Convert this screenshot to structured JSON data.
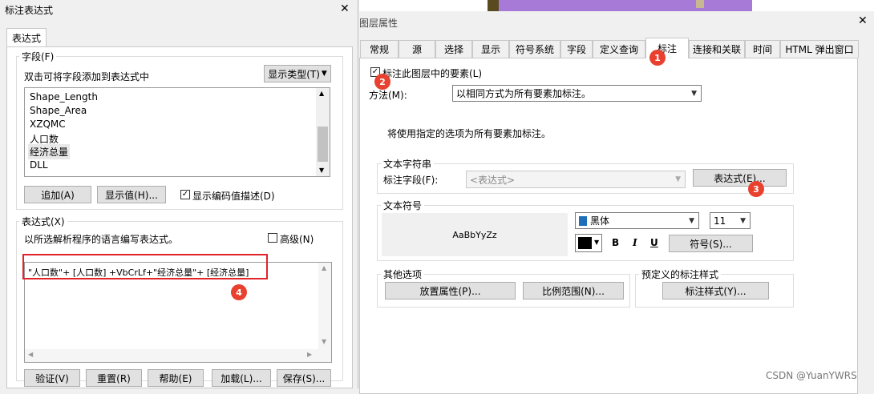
{
  "left": {
    "title": "标注表达式",
    "close": "✕",
    "tab": "表达式",
    "fields": {
      "group_title": "字段(F)",
      "hint": "双击可将字段添加到表达式中",
      "show_type": "显示类型(T)",
      "items": [
        "Shape_Length",
        "Shape_Area",
        "XZQMC",
        "人口数",
        "经济总量",
        "DLL"
      ],
      "add_btn": "追加(A)",
      "show_values_btn": "显示值(H)...",
      "show_coded_label": "显示编码值描述(D)"
    },
    "expression": {
      "group_title": "表达式(X)",
      "hint": "以所选解析程序的语言编写表达式。",
      "advanced_label": "高级(N)",
      "text": "\"人口数\"+ [人口数] +VbCrLf+\"经济总量\"+ [经济总量]"
    },
    "buttons": {
      "verify": "验证(V)",
      "reset": "重置(R)",
      "help": "帮助(E)",
      "load": "加载(L)...",
      "save": "保存(S)..."
    }
  },
  "right": {
    "title": "图层属性",
    "tabs": [
      "常规",
      "源",
      "选择",
      "显示",
      "符号系统",
      "字段",
      "定义查询",
      "标注",
      "连接和关联",
      "时间",
      "HTML 弹出窗口"
    ],
    "label_features": "标注此图层中的要素(L)",
    "method_label": "方法(M):",
    "method_value": "以相同方式为所有要素加标注。",
    "info": "将使用指定的选项为所有要素加标注。",
    "text_string": {
      "group_title": "文本字符串",
      "field_label": "标注字段(F):",
      "field_value": "<表达式>",
      "expr_btn": "表达式(E)..."
    },
    "text_symbol": {
      "group_title": "文本符号",
      "preview": "AaBbYyZz",
      "font": "黑体",
      "size": "11",
      "bold": "B",
      "italic": "I",
      "underline": "U",
      "symbol_btn": "符号(S)..."
    },
    "other": {
      "group_title": "其他选项",
      "placement_btn": "放置属性(P)...",
      "scale_btn": "比例范围(N)..."
    },
    "predefined": {
      "group_title": "预定义的标注样式",
      "style_btn": "标注样式(Y)..."
    }
  },
  "badges": [
    "1",
    "2",
    "3",
    "4"
  ],
  "watermark": "CSDN @YuanYWRS",
  "colors": {
    "accent": "#e8412f",
    "highlight": "#e0242a",
    "map_purple": "#a87ad8"
  }
}
